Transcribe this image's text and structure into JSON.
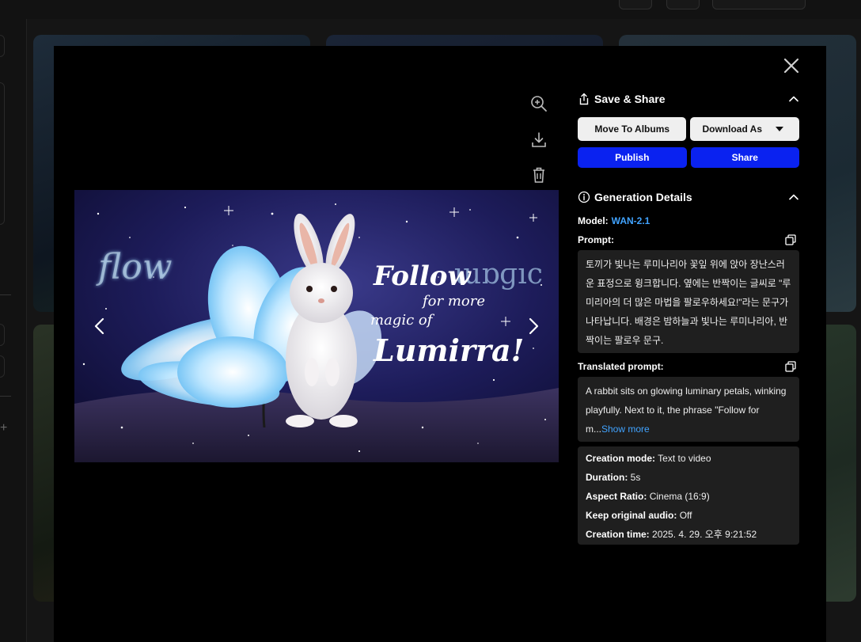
{
  "save_share": {
    "title": "Save & Share",
    "move_to_albums": "Move To Albums",
    "download_as": "Download As",
    "publish": "Publish",
    "share": "Share"
  },
  "generation": {
    "title": "Generation Details",
    "model_label": "Model:",
    "model_value": "WAN-2.1",
    "prompt_label": "Prompt:",
    "prompt_text": "토끼가 빛나는 루미나리아 꽃잎 위에 앉아 장난스러운 표정으로 윙크합니다. 옆에는 반짝이는 글씨로 \"루미리아의 더 많은 마법을 팔로우하세요!\"라는 문구가 나타납니다. 배경은 밤하늘과 빛나는 루미나리아, 반짝이는 팔로우 문구.",
    "translated_label": "Translated prompt:",
    "translated_text": "A rabbit sits on glowing luminary petals, winking playfully. Next to it, the phrase \"Follow for m...",
    "show_more": "Show more",
    "details": [
      {
        "label": "Creation mode:",
        "value": "Text to video"
      },
      {
        "label": "Duration:",
        "value": "5s"
      },
      {
        "label": "Aspect Ratio:",
        "value": "Cinema (16:9)"
      },
      {
        "label": "Keep original audio:",
        "value": "Off"
      },
      {
        "label": "Creation time:",
        "value": "2025. 4. 29. 오후 9:21:52"
      }
    ]
  },
  "image_text": {
    "faded_word_left": "flow",
    "faded_word_right": "ɯɒɡıc",
    "line1": "Follow",
    "line2": "for more",
    "line3": "magic of",
    "line4": "Lumirra!"
  },
  "icons": {
    "close": "close-icon",
    "zoom": "zoom-in-icon",
    "download": "download-icon",
    "delete": "trash-icon",
    "favorite": "star-icon",
    "share_section": "share-icon",
    "info": "info-icon",
    "collapse": "chevron-up-icon",
    "copy": "copy-icon",
    "prev": "chevron-left-icon",
    "next": "chevron-right-icon"
  },
  "colors": {
    "accent_blue": "#0a22f0",
    "link_blue": "#41a3ff",
    "modal_bg": "#000000",
    "box_bg": "#1f1f1f"
  }
}
